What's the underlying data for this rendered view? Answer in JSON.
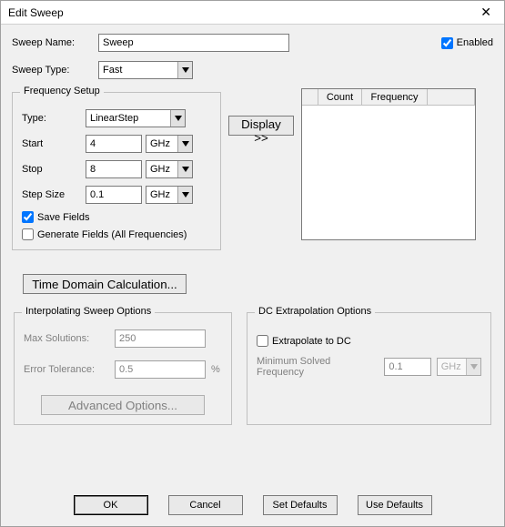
{
  "window": {
    "title": "Edit Sweep"
  },
  "form": {
    "sweep_name_label": "Sweep Name:",
    "sweep_name_value": "Sweep",
    "enabled_label": "Enabled",
    "sweep_type_label": "Sweep Type:",
    "sweep_type_value": "Fast"
  },
  "freq": {
    "group_title": "Frequency Setup",
    "type_label": "Type:",
    "type_value": "LinearStep",
    "start_label": "Start",
    "start_value": "4",
    "start_unit": "GHz",
    "stop_label": "Stop",
    "stop_value": "8",
    "stop_unit": "GHz",
    "step_label": "Step Size",
    "step_value": "0.1",
    "step_unit": "GHz",
    "save_fields_label": "Save Fields",
    "generate_fields_label": "Generate Fields (All Frequencies)"
  },
  "display_button": "Display >>",
  "table": {
    "col_count": "Count",
    "col_frequency": "Frequency"
  },
  "time_domain_button": "Time Domain Calculation...",
  "interp": {
    "group_title": "Interpolating Sweep Options",
    "max_solutions_label": "Max Solutions:",
    "max_solutions_value": "250",
    "error_tol_label": "Error Tolerance:",
    "error_tol_value": "0.5",
    "error_tol_unit": "%",
    "advanced_button": "Advanced Options..."
  },
  "dc": {
    "group_title": "DC Extrapolation Options",
    "extrapolate_label": "Extrapolate to DC",
    "min_freq_label": "Minimum Solved Frequency",
    "min_freq_value": "0.1",
    "min_freq_unit": "GHz"
  },
  "footer": {
    "ok": "OK",
    "cancel": "Cancel",
    "set_defaults": "Set Defaults",
    "use_defaults": "Use Defaults"
  }
}
